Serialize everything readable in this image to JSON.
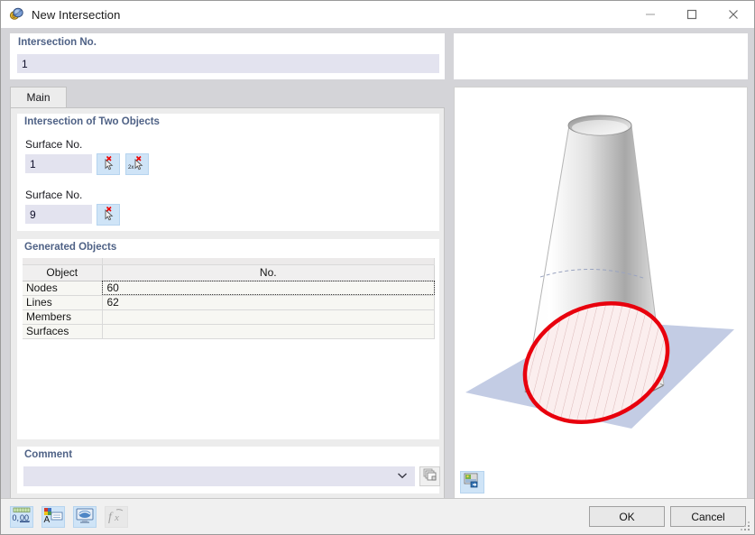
{
  "window": {
    "title": "New Intersection",
    "icon": "intersection-icon",
    "minimize_label": "—",
    "maximize_label": "☐",
    "close_label": "✕"
  },
  "intersection_no": {
    "caption": "Intersection No.",
    "value": "1"
  },
  "tabs": [
    {
      "label": "Main",
      "selected": true
    }
  ],
  "two_objects": {
    "caption": "Intersection of Two Objects",
    "first": {
      "label": "Surface No.",
      "value": "1",
      "pick_single_icon": "pick-cursor-icon",
      "pick_double_icon": "pick-cursor-2x-icon"
    },
    "second": {
      "label": "Surface No.",
      "value": "9",
      "pick_single_icon": "pick-cursor-icon"
    }
  },
  "generated_objects": {
    "caption": "Generated Objects",
    "columns": [
      "Object",
      "No."
    ],
    "rows": [
      {
        "object": "Nodes",
        "no": "60",
        "focused": true
      },
      {
        "object": "Lines",
        "no": "62",
        "focused": false
      },
      {
        "object": "Members",
        "no": "",
        "focused": false
      },
      {
        "object": "Surfaces",
        "no": "",
        "focused": false
      }
    ]
  },
  "comment": {
    "caption": "Comment",
    "value": "",
    "placeholder": "",
    "dropdown_icon": "chevron-down-icon",
    "aux_button_icon": "comment-library-icon"
  },
  "graphic": {
    "image_button_icon": "image-settings-icon",
    "description": "truncated-cone-plane-intersection"
  },
  "footer": {
    "tools": [
      {
        "name": "decimal-places-button",
        "icon": "decimal-0-00-icon",
        "label": "0,00",
        "disabled": false
      },
      {
        "name": "units-format-button",
        "icon": "units-colors-icon",
        "label": "",
        "disabled": false
      },
      {
        "name": "display-properties-button",
        "icon": "monitor-blue-icon",
        "label": "",
        "disabled": false
      },
      {
        "name": "formula-button",
        "icon": "fx-formula-icon",
        "label": "f",
        "disabled": true
      }
    ],
    "ok_label": "OK",
    "cancel_label": "Cancel"
  },
  "colors": {
    "caption": "#4f6286",
    "input_bg": "#e3e3ef",
    "pick_btn_bg": "#cfe4f7",
    "plane": "#c3cce4",
    "ellipse_outline": "#e8000d",
    "ellipse_fill": "#fbeeee",
    "window_bg": "#d4d4d8"
  }
}
